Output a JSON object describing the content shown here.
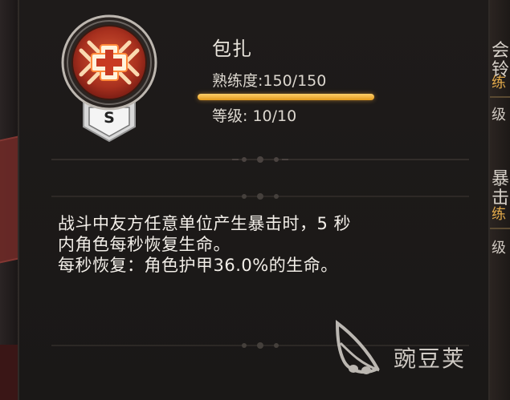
{
  "skill": {
    "name": "包扎",
    "grade_letter": "S",
    "proficiency_text": "熟练度:150/150",
    "proficiency_fraction": 1.0,
    "level_text": "等级: 10/10"
  },
  "description": {
    "line1": "战斗中友方任意单位产生暴击时，5 秒",
    "line2": "内角色每秒恢复生命。",
    "line3": "每秒恢复：角色护甲36.0%的生命。"
  },
  "watermark": {
    "text": "豌豆荚"
  },
  "background_right": {
    "fragment_1": "会铃",
    "fragment_2": "练",
    "fragment_3": "级",
    "fragment_4": "暴击",
    "fragment_5": "练",
    "fragment_6": "级"
  },
  "colors": {
    "accent_gold": "#e9a22a",
    "badge_red": "#b23a22",
    "text_light": "#e9e4dc"
  },
  "icons": {
    "badge": "medic-cross-icon",
    "watermark": "pea-pod-logo-icon"
  }
}
